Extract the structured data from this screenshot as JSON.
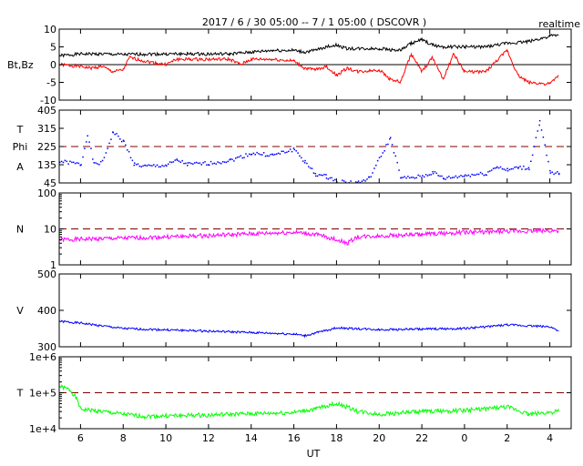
{
  "title": "2017 / 6 / 30  05:00 -- 7 / 1  05:00 ( DSCOVR )",
  "mode_label": "realtime",
  "xlabel": "UT",
  "chart_data": [
    {
      "type": "line",
      "name": "Bt,Bz",
      "ylabel": [
        "Bt,Bz"
      ],
      "scale": "linear",
      "ylim": [
        -10,
        10
      ],
      "yticks": [
        "10",
        "5",
        "0",
        "-5",
        "-10"
      ],
      "ytick_values": [
        10,
        5,
        0,
        -5,
        -10
      ],
      "ref_line": 0,
      "ref_style": "solid",
      "series": [
        {
          "name": "Bt",
          "color": "#000000",
          "x": [
            5,
            6,
            7,
            8,
            9,
            10,
            11,
            12,
            13,
            14,
            15,
            16,
            16.5,
            17,
            17.5,
            18,
            18.5,
            19,
            20,
            21,
            21.5,
            22,
            22.5,
            23,
            24,
            25,
            26,
            27,
            28,
            28.4
          ],
          "y": [
            2.5,
            3,
            3,
            2.8,
            3,
            3,
            3,
            3,
            3,
            3.5,
            4,
            4,
            3.5,
            4,
            5,
            5.5,
            4.5,
            4.5,
            4.5,
            4,
            6,
            7,
            5.5,
            5,
            5,
            5,
            6,
            6.5,
            8,
            8.3
          ]
        },
        {
          "name": "Bz",
          "color": "#ff0000",
          "x": [
            5,
            6,
            6.5,
            7,
            7.5,
            8,
            8.3,
            9,
            10,
            10.5,
            11,
            12,
            13,
            13.5,
            14,
            15,
            16,
            16.5,
            17,
            17.5,
            18,
            18.5,
            19,
            20,
            20.5,
            21,
            21.5,
            22,
            22.5,
            23,
            23.5,
            24,
            25,
            26,
            26.5,
            27,
            28,
            28.4
          ],
          "y": [
            0,
            -0.5,
            -1,
            -0.5,
            -2,
            -1.5,
            2,
            1,
            0,
            1.5,
            1.5,
            1.5,
            1.5,
            0,
            1.5,
            1.5,
            1,
            -1,
            -1.5,
            -0.5,
            -3,
            -1,
            -2,
            -1.5,
            -4,
            -5,
            3,
            -2,
            2,
            -4,
            3,
            -2,
            -2,
            4,
            -3,
            -5,
            -5.5,
            -3
          ]
        }
      ]
    },
    {
      "type": "scatter",
      "name": "Phi",
      "ylabel": [
        "T",
        "Phi",
        "A"
      ],
      "scale": "linear",
      "ylim": [
        45,
        405
      ],
      "yticks": [
        "405",
        "315",
        "225",
        "135",
        "45"
      ],
      "ytick_values": [
        405,
        315,
        225,
        135,
        45
      ],
      "ref_line": 225,
      "ref_style": "dashed",
      "series": [
        {
          "name": "Phi",
          "color": "#0000ff",
          "x": [
            5,
            6,
            6.3,
            6.6,
            7,
            7.5,
            8,
            8.5,
            9,
            10,
            10.5,
            11,
            12,
            13,
            14,
            15,
            16,
            16.5,
            17,
            17.5,
            18,
            19,
            19.5,
            20.5,
            21,
            22,
            22.5,
            23,
            24,
            25,
            25.5,
            26,
            26.5,
            27,
            27.5,
            28,
            28.4
          ],
          "y": [
            155,
            140,
            290,
            140,
            150,
            300,
            250,
            140,
            130,
            135,
            160,
            140,
            145,
            160,
            195,
            185,
            215,
            150,
            90,
            80,
            55,
            50,
            70,
            270,
            70,
            80,
            100,
            70,
            85,
            95,
            130,
            110,
            125,
            120,
            350,
            95,
            95
          ]
        }
      ]
    },
    {
      "type": "line",
      "name": "N",
      "ylabel": [
        "N"
      ],
      "scale": "log",
      "ylim": [
        1,
        100
      ],
      "yticks": [
        "100",
        "10",
        "1"
      ],
      "ytick_values": [
        100,
        10,
        1
      ],
      "ref_line": 10,
      "ref_style": "dashed",
      "series": [
        {
          "name": "N",
          "color": "#ff00ff",
          "x": [
            5,
            8,
            12,
            16,
            17,
            18.5,
            19,
            22,
            24,
            28.4
          ],
          "y": [
            5,
            5.5,
            6.5,
            8,
            7,
            4,
            6,
            7,
            8,
            9
          ]
        }
      ]
    },
    {
      "type": "line",
      "name": "V",
      "ylabel": [
        "V"
      ],
      "scale": "linear",
      "ylim": [
        300,
        500
      ],
      "yticks": [
        "500",
        "400",
        "300"
      ],
      "ytick_values": [
        500,
        400,
        300
      ],
      "series": [
        {
          "name": "V",
          "color": "#0000ff",
          "x": [
            5,
            6,
            8,
            12,
            16,
            16.5,
            18,
            20,
            24,
            26,
            28,
            28.4
          ],
          "y": [
            370,
            365,
            350,
            343,
            335,
            330,
            352,
            347,
            350,
            360,
            355,
            345
          ]
        }
      ]
    },
    {
      "type": "line",
      "name": "T",
      "ylabel": [
        "T"
      ],
      "scale": "log",
      "ylim": [
        10000,
        1000000
      ],
      "yticks": [
        "1e+6",
        "1e+5",
        "1e+4"
      ],
      "ytick_values": [
        1000000,
        100000,
        10000
      ],
      "ref_line": 100000,
      "ref_style": "dashed",
      "series": [
        {
          "name": "T",
          "color": "#00ff00",
          "x": [
            5,
            5.5,
            6,
            8,
            9,
            12,
            16,
            17,
            18,
            19,
            20,
            22,
            24,
            26,
            27,
            28.4
          ],
          "y": [
            150000,
            120000,
            35000,
            25000,
            22000,
            24000,
            28000,
            35000,
            50000,
            30000,
            25000,
            30000,
            32000,
            40000,
            25000,
            30000
          ]
        }
      ]
    }
  ],
  "xlim": [
    5,
    29
  ],
  "xticks": [
    {
      "v": 6,
      "label": "6"
    },
    {
      "v": 8,
      "label": "8"
    },
    {
      "v": 10,
      "label": "10"
    },
    {
      "v": 12,
      "label": "12"
    },
    {
      "v": 14,
      "label": "14"
    },
    {
      "v": 16,
      "label": "16"
    },
    {
      "v": 18,
      "label": "18"
    },
    {
      "v": 20,
      "label": "20"
    },
    {
      "v": 22,
      "label": "22"
    },
    {
      "v": 24,
      "label": "0"
    },
    {
      "v": 26,
      "label": "2"
    },
    {
      "v": 28,
      "label": "4"
    }
  ]
}
